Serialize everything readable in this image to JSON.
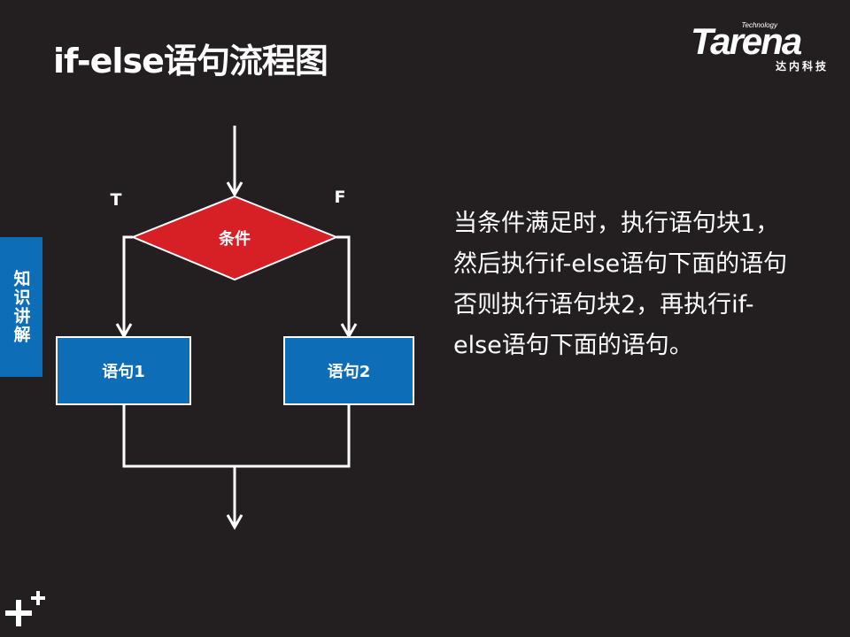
{
  "slide": {
    "title": "if-else语句流程图"
  },
  "logo": {
    "technology": "Technology",
    "wordmark": "Tarena",
    "subtitle": "达内科技"
  },
  "side_tab": {
    "label": "知识讲解"
  },
  "flowchart": {
    "decision_label": "条件",
    "true_label": "T",
    "false_label": "F",
    "box_true_label": "语句1",
    "box_false_label": "语句2",
    "colors": {
      "decision_fill": "#d71f26",
      "box_fill": "#0d6db7",
      "stroke": "#ffffff"
    }
  },
  "description": {
    "lines": [
      "当条件满足时，执行语句块1，",
      "然后执行if-else语句下面的语句",
      "否则执行语句块2，再执行if-",
      "else语句下面的语句。"
    ]
  },
  "icons": {
    "corner": "plus-plus-icon"
  }
}
